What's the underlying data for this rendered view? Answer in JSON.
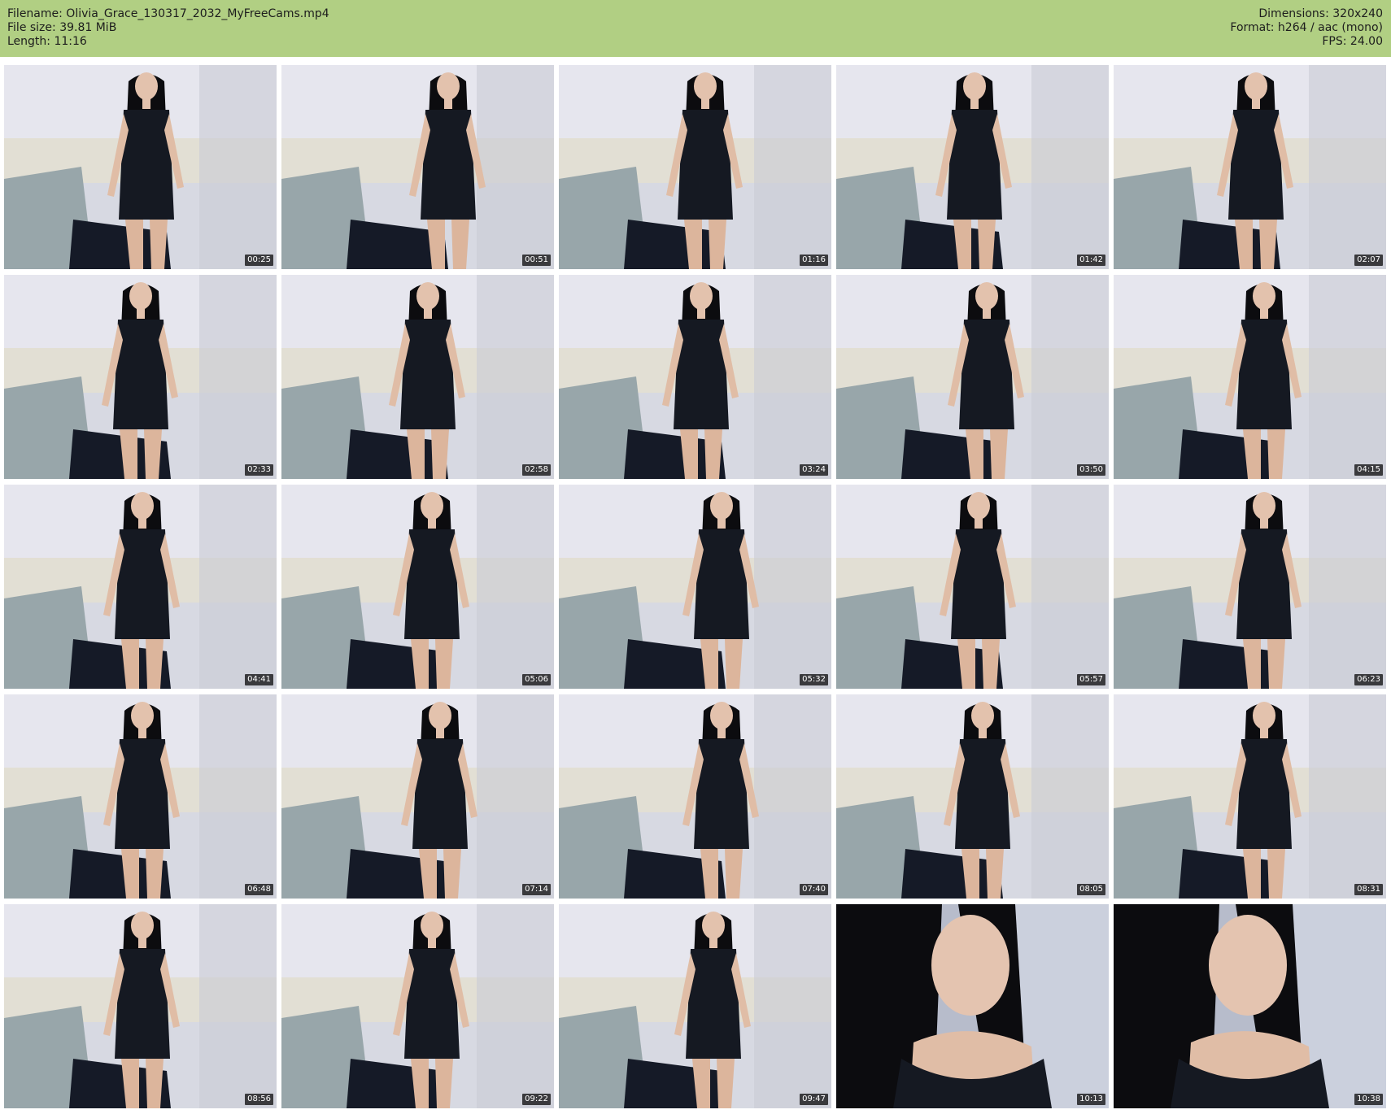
{
  "header": {
    "filename": "Filename: Olivia_Grace_130317_2032_MyFreeCams.mp4",
    "file_size": "File size: 39.81 MiB",
    "length": "Length: 11:16",
    "dimensions": "Dimensions: 320x240",
    "format": "Format: h264 / aac (mono)",
    "fps": "FPS: 24.00"
  },
  "colors": {
    "header_bg": "#b1cf83",
    "dress": "#151922",
    "hair": "#0c0c0f",
    "wall": "#d7d9e2",
    "couch": "#98a6aa"
  },
  "thumbnails": [
    {
      "timestamp": "00:25"
    },
    {
      "timestamp": "00:51"
    },
    {
      "timestamp": "01:16"
    },
    {
      "timestamp": "01:42"
    },
    {
      "timestamp": "02:07"
    },
    {
      "timestamp": "02:33"
    },
    {
      "timestamp": "02:58"
    },
    {
      "timestamp": "03:24"
    },
    {
      "timestamp": "03:50"
    },
    {
      "timestamp": "04:15"
    },
    {
      "timestamp": "04:41"
    },
    {
      "timestamp": "05:06"
    },
    {
      "timestamp": "05:32"
    },
    {
      "timestamp": "05:57"
    },
    {
      "timestamp": "06:23"
    },
    {
      "timestamp": "06:48"
    },
    {
      "timestamp": "07:14"
    },
    {
      "timestamp": "07:40"
    },
    {
      "timestamp": "08:05"
    },
    {
      "timestamp": "08:31"
    },
    {
      "timestamp": "08:56"
    },
    {
      "timestamp": "09:22"
    },
    {
      "timestamp": "09:47"
    },
    {
      "timestamp": "10:13"
    },
    {
      "timestamp": "10:38"
    }
  ]
}
